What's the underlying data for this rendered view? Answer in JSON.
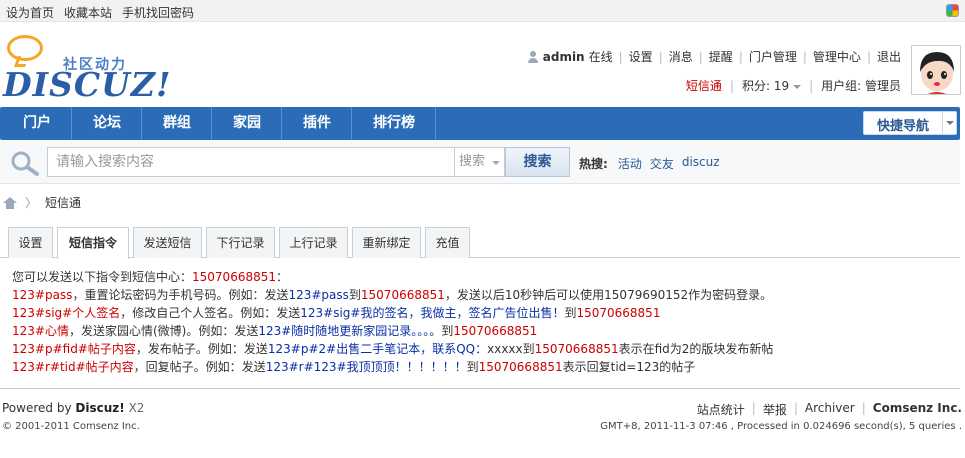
{
  "topbar": {
    "links": [
      "设为首页",
      "收藏本站",
      "手机找回密码"
    ]
  },
  "logo": {
    "tagline": "社区动力",
    "wordmark": "DISCUZ!"
  },
  "usernav": {
    "username": "admin",
    "status": "在线",
    "links": [
      "设置",
      "消息",
      "提醒",
      "门户管理",
      "管理中心",
      "退出"
    ]
  },
  "userinfo": {
    "sms": "短信通",
    "credits": "积分: 19",
    "group": "用户组: 管理员"
  },
  "nav": {
    "items": [
      "门户",
      "论坛",
      "群组",
      "家园",
      "插件",
      "排行榜"
    ],
    "quicknav": "快捷导航"
  },
  "search": {
    "placeholder": "请输入搜索内容",
    "type": "搜索",
    "button": "搜索",
    "hot_label": "热搜:",
    "hot_words": [
      "活动",
      "交友",
      "discuz"
    ]
  },
  "breadcrumb": {
    "current": "短信通"
  },
  "tabs": [
    "设置",
    "短信指令",
    "发送短信",
    "下行记录",
    "上行记录",
    "重新绑定",
    "充值"
  ],
  "content": {
    "intro_a": "您可以发送以下指令到短信中心：",
    "number": "15070668851",
    "intro_b": "：",
    "rows": [
      {
        "cmd": "123#pass",
        "desc": "，重置论坛密码为手机号码。例如：发送",
        "ex": "123#pass",
        "to": "到",
        "num": "15070668851",
        "tail": "，发送以后10秒钟后可以使用15079690152作为密码登录。"
      },
      {
        "cmd": "123#sig#个人签名",
        "desc": "，修改自己个人签名。例如：发送",
        "ex": "123#sig#我的签名，我做主，签名广告位出售！",
        "to": "到",
        "num": "15070668851",
        "tail": ""
      },
      {
        "cmd": "123#心情",
        "desc": "，发送家园心情(微博)。例如：发送",
        "ex": "123#随时随地更新家园记录。。。。",
        "to": "到",
        "num": "15070668851",
        "tail": ""
      },
      {
        "cmd": "123#p#fid#帖子内容",
        "desc": "，发布帖子。例如：发送",
        "ex": "123#p#2#出售二手笔记本，联系QQ：",
        "to": "xxxxx到",
        "num": "15070668851",
        "tail": "表示在fid为2的版块发布新帖"
      },
      {
        "cmd": "123#r#tid#帖子内容",
        "desc": "，回复帖子。例如：发送",
        "ex": "123#r#123#我顶顶顶！！！！！！",
        "to": "到",
        "num": "15070668851",
        "tail": "表示回复tid=123的帖子"
      }
    ]
  },
  "footer": {
    "powered_by": "Powered by",
    "brand": "Discuz!",
    "version": "X2",
    "copyright": "© 2001-2011 Comsenz Inc.",
    "links": [
      "站点统计",
      "举报",
      "Archiver",
      "Comsenz Inc."
    ],
    "debug": "GMT+8, 2011-11-3 07:46 , Processed in 0.024696 second(s), 5 queries ."
  },
  "colors": {
    "nav_bg": "#2b6cb8",
    "link_red": "#cc0000",
    "example_blue": "#0a2fa6"
  }
}
